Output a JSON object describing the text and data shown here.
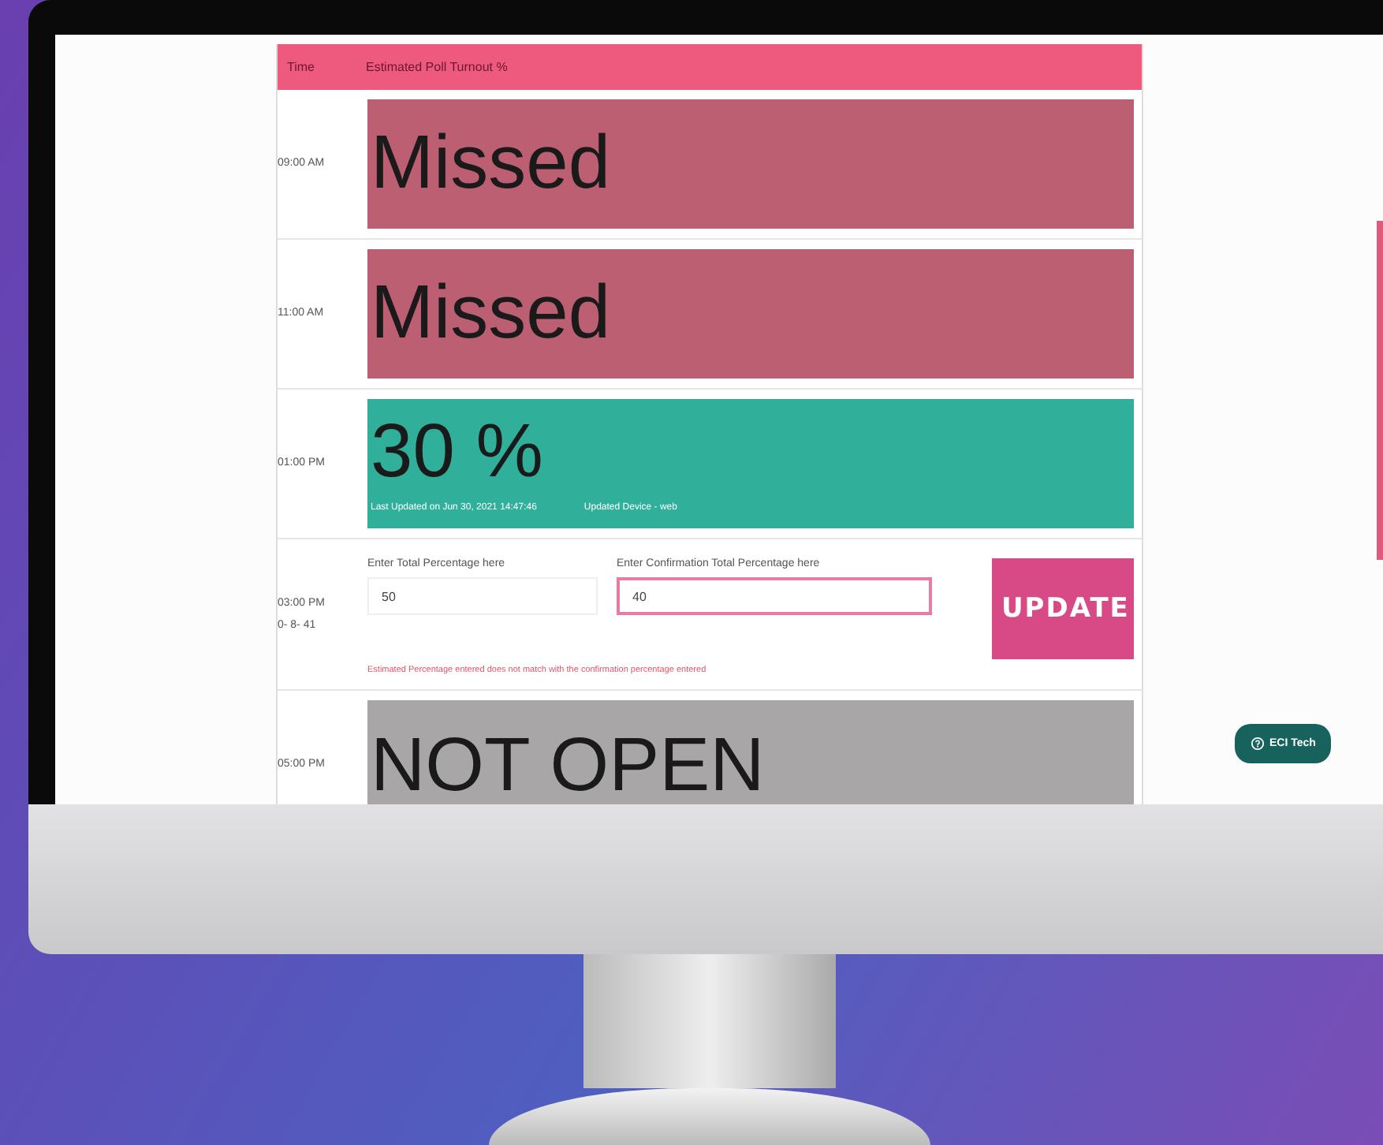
{
  "table": {
    "columns": [
      "Time",
      "Estimated Poll Turnout %"
    ],
    "rows": [
      {
        "time": [
          "09:00 AM"
        ],
        "kind": "missed",
        "value": "Missed"
      },
      {
        "time": [
          "11:00 AM"
        ],
        "kind": "missed",
        "value": "Missed"
      },
      {
        "time": [
          "01:00 PM"
        ],
        "kind": "reported",
        "value": "30 %",
        "updated": "Last Updated on Jun 30, 2021 14:47:46",
        "device": "Updated Device - web"
      },
      {
        "time": [
          "03:00 PM",
          "0- 8- 41"
        ],
        "kind": "form",
        "total_label": "Enter Total Percentage here",
        "total_value": "50",
        "confirm_label": "Enter Confirmation Total Percentage here",
        "confirm_value": "40",
        "error": "Estimated Percentage entered does not match with the confirmation percentage entered",
        "button": "UPDATE"
      },
      {
        "time": [
          "05:00 PM"
        ],
        "kind": "not_open",
        "value": "NOT OPEN"
      }
    ]
  },
  "help_button": "ECI Tech"
}
